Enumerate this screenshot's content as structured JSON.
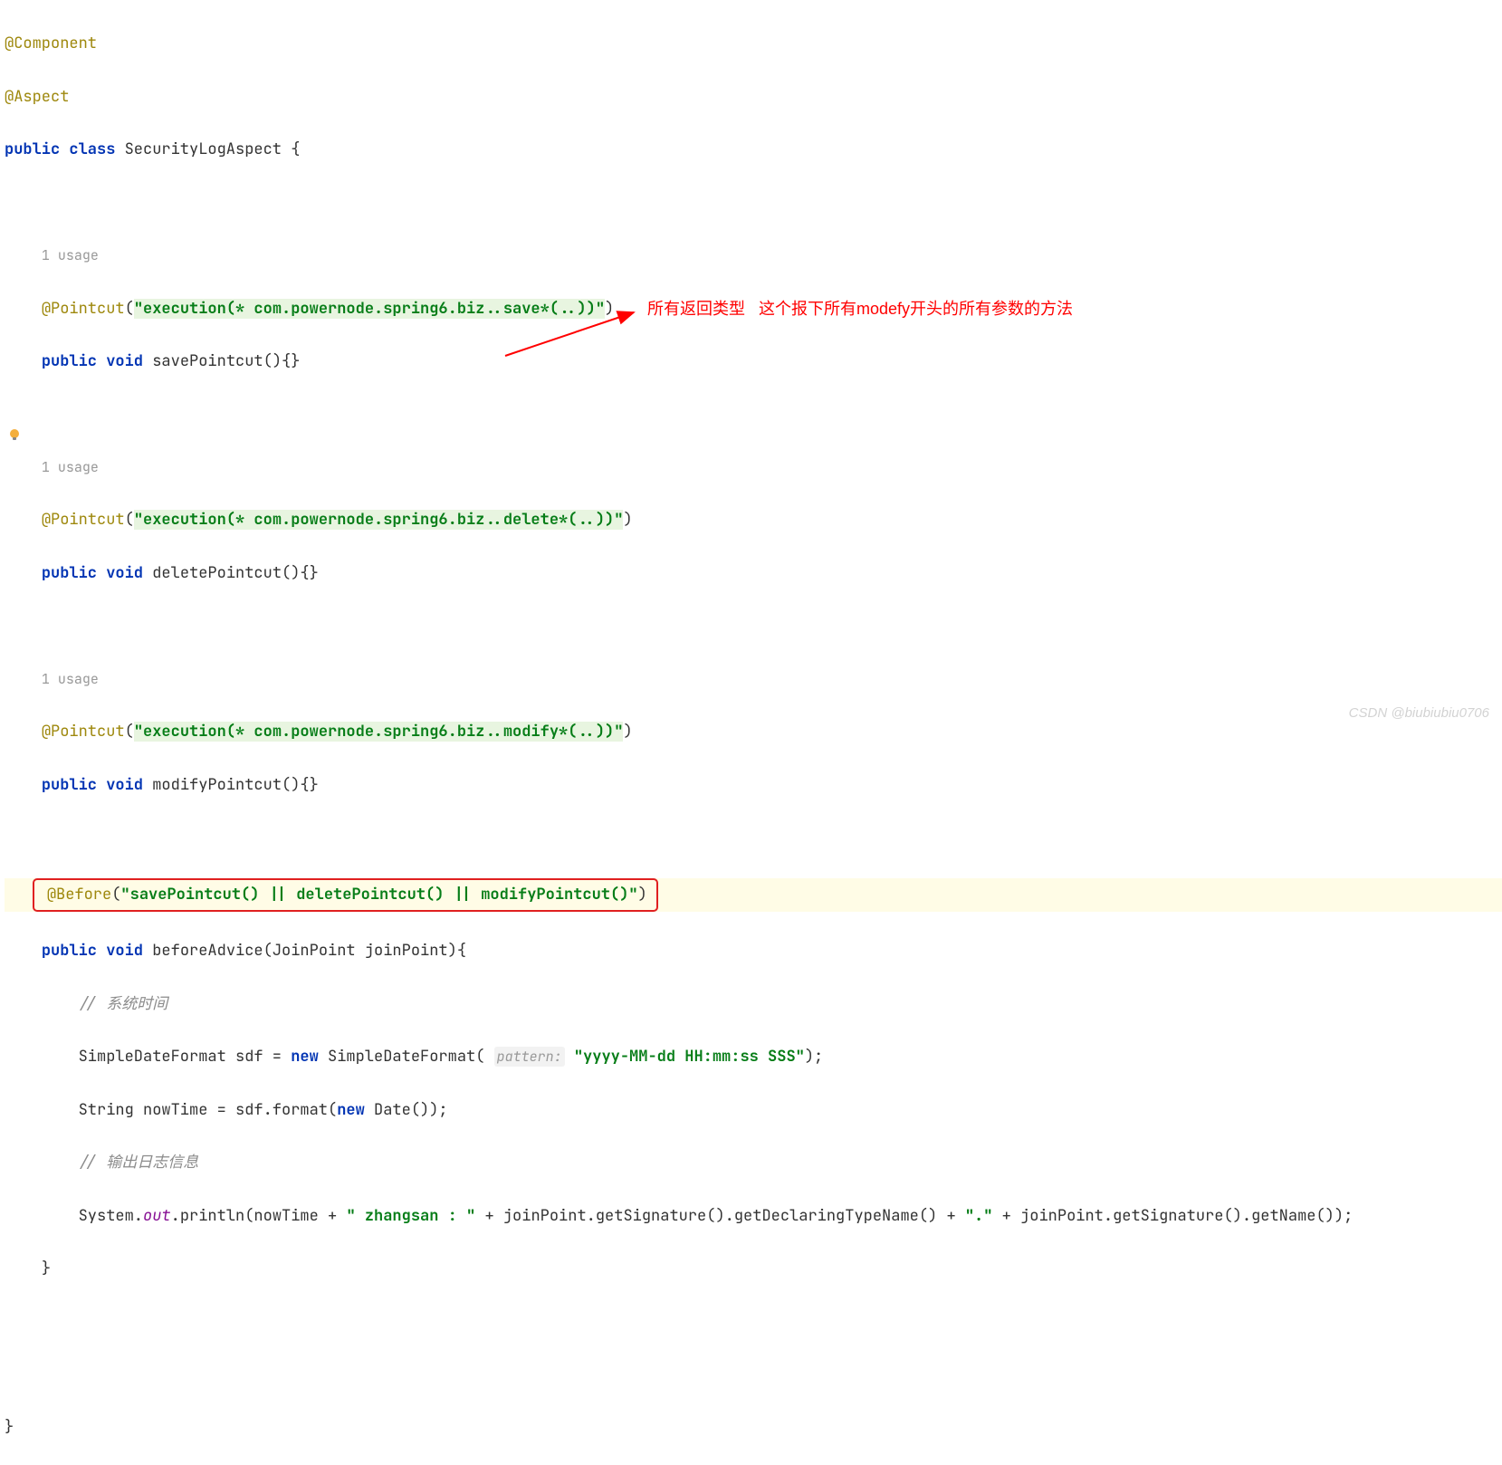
{
  "code": {
    "annotation1": "@Component",
    "annotation2": "@Aspect",
    "classDecl": {
      "keywords": "public class",
      "name": "SecurityLogAspect",
      "brace": " {"
    },
    "usage1": "1 usage",
    "pointcut1": {
      "ann": "@Pointcut",
      "open": "(",
      "str": "\"execution(* com.powernode.spring6.biz..save*(..))\"",
      "close": ")"
    },
    "method1": {
      "keywords": "public void",
      "name": " savePointcut(){}"
    },
    "usage2": "1 usage",
    "pointcut2": {
      "ann": "@Pointcut",
      "open": "(",
      "str": "\"execution(* com.powernode.spring6.biz..delete*(..))\"",
      "close": ")"
    },
    "method2": {
      "keywords": "public void",
      "name": " deletePointcut(){}"
    },
    "usage3": "1 usage",
    "pointcut3": {
      "ann": "@Pointcut",
      "open": "(",
      "str": "\"execution(* com.powernode.spring6.biz..modify*(..))\"",
      "close": ")"
    },
    "method3": {
      "keywords": "public void",
      "name": " modifyPointcut(){}"
    },
    "before": {
      "ann": "@Before",
      "open": "(",
      "str": "\"savePointcut() || deletePointcut() || modifyPointcut()\"",
      "close": ")"
    },
    "method4": {
      "keywords": "public void",
      "name": " beforeAdvice(JoinPoint joinPoint){"
    },
    "comment1": "// 系统时间",
    "sdf": {
      "prefix": "SimpleDateFormat sdf = ",
      "newKw": "new",
      "ctor": " SimpleDateFormat( ",
      "paramHint": "pattern:",
      "space": " ",
      "str": "\"yyyy-MM-dd HH:mm:ss SSS\"",
      "close": ");"
    },
    "nowTime": {
      "prefix": "String nowTime = sdf.format(",
      "newKw": "new",
      "rest": " Date());"
    },
    "comment2": "// 输出日志信息",
    "println": {
      "p1": "System.",
      "out": "out",
      "p2": ".println(nowTime + ",
      "str1": "\" zhangsan : \"",
      "p3": " + joinPoint.getSignature().getDeclaringTypeName() + ",
      "str2": "\".\"",
      "p4": " + joinPoint.getSignature().getName());"
    },
    "closeBrace1": "}",
    "closeBrace2": "}"
  },
  "annotation": {
    "text1": "所有返回类型",
    "text2": "这个报下所有modefy开头的所有参数的方法"
  },
  "watermark": "CSDN @biubiubiu0706"
}
